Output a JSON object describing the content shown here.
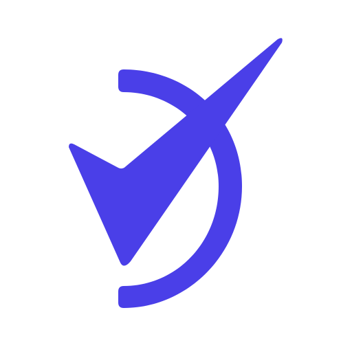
{
  "logo": {
    "icon": "checkmark-arc-logo",
    "color": "#4a3fe8",
    "background": "#ffffff"
  }
}
